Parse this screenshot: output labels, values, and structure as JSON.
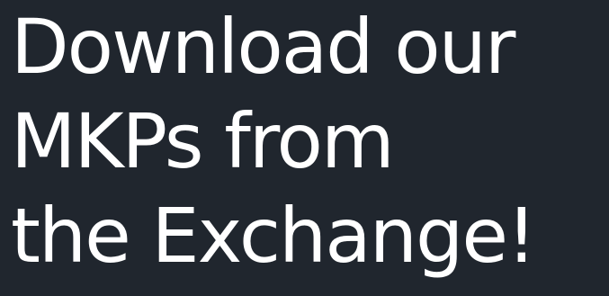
{
  "headline": {
    "lines": [
      "Download our",
      "MKPs from",
      "the Exchange!"
    ]
  },
  "colors": {
    "background": "#20262e",
    "text": "#ffffff"
  }
}
